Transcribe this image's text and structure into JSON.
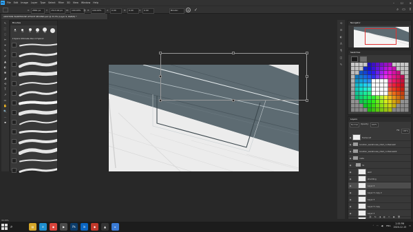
{
  "menubar": {
    "logo": "Ps",
    "items": [
      "File",
      "Edit",
      "Image",
      "Layer",
      "Type",
      "Select",
      "Filter",
      "3D",
      "View",
      "Window",
      "Help"
    ],
    "window_controls": [
      "–",
      "☐",
      "✕"
    ]
  },
  "options": {
    "x_value": "2861 px",
    "y_value": "1513.00 px",
    "w_value": "100.00%",
    "h_value": "100.00%",
    "angle": "0.00",
    "h_skew": "0.00",
    "v_skew": "0.00",
    "interpolation": "Bicubic"
  },
  "document": {
    "title": "ADDITION WAREHOUSE ATTACH SECOND.psd @ 33.3% (Layer 6, RGB/8) *"
  },
  "tools": [
    "↖",
    "⬚",
    "◌",
    "✂",
    "⌖",
    "✎",
    "✐",
    "▲",
    "◐",
    "✱",
    "◢",
    "⟲",
    "T",
    "↗",
    "▭",
    "✋",
    "🔍",
    "…",
    "▪"
  ],
  "brushes": {
    "title": "Brushes",
    "sizes": [
      {
        "size": "30",
        "d": 2
      },
      {
        "size": "30",
        "d": 3
      },
      {
        "size": "30",
        "d": 4
      },
      {
        "size": "25",
        "d": 5
      },
      {
        "size": "50",
        "d": 6
      },
      {
        "size": "",
        "d": 7
      }
    ],
    "folder": "Kyle's Ultimate Pencil Hybrid",
    "stroke_count": 14
  },
  "navigator": {
    "title": "Navigator"
  },
  "swatches": {
    "title": "Swatches"
  },
  "layers": {
    "title": "Layers",
    "blend_mode": "Normal",
    "opacity_label": "Opacity:",
    "opacity": "100%",
    "fill_label": "Fill:",
    "fill": "100%",
    "items": [
      {
        "name": "frame ref",
        "type": "layer",
        "indent": 0,
        "selected": false
      },
      {
        "name": "location_warehouse_shed_curtainwall",
        "type": "group",
        "indent": 0,
        "selected": false
      },
      {
        "name": "location_warehouse_shed_curtainwall2",
        "type": "group",
        "indent": 0,
        "selected": false
      },
      {
        "name": "vista",
        "type": "group",
        "indent": 0,
        "selected": false
      },
      {
        "name": "hs",
        "type": "group",
        "indent": 1,
        "selected": false
      },
      {
        "name": "wall",
        "type": "layer",
        "indent": 2,
        "selected": false
      },
      {
        "name": "shedding",
        "type": "layer",
        "indent": 2,
        "selected": false
      },
      {
        "name": "Layer 6",
        "type": "layer",
        "indent": 2,
        "selected": true
      },
      {
        "name": "Layer 5 copy 2",
        "type": "layer",
        "indent": 2,
        "selected": false
      },
      {
        "name": "Layer 5",
        "type": "layer",
        "indent": 2,
        "selected": false
      },
      {
        "name": "Layer 5 copy",
        "type": "layer",
        "indent": 2,
        "selected": false
      },
      {
        "name": "Layer 4",
        "type": "layer",
        "indent": 2,
        "selected": false
      },
      {
        "name": "Layer 3",
        "type": "layer",
        "indent": 2,
        "selected": false
      },
      {
        "name": "Layer 2",
        "type": "layer",
        "indent": 2,
        "selected": false
      }
    ],
    "footer_icons": [
      "⛓",
      "fx",
      "◑",
      "◐",
      "▭",
      "▣",
      "🗑"
    ]
  },
  "status": {
    "zoom": "33.33%"
  },
  "taskbar": {
    "apps": [
      {
        "name": "file-explorer",
        "glyph": "▤",
        "color": "#d6a82a"
      },
      {
        "name": "edge",
        "glyph": "e",
        "color": "#1f8fd0"
      },
      {
        "name": "chrome",
        "glyph": "◉",
        "color": "#d9453c"
      },
      {
        "name": "media",
        "glyph": "▶",
        "color": "#4b4b4b"
      },
      {
        "name": "photoshop",
        "glyph": "Ps",
        "color": "#0b3c6b"
      },
      {
        "name": "linkedin",
        "glyph": "in",
        "color": "#0a66c2"
      },
      {
        "name": "sketchup",
        "glyph": "◆",
        "color": "#c0392b"
      },
      {
        "name": "app-dark",
        "glyph": "▲",
        "color": "#333333"
      },
      {
        "name": "app-blue",
        "glyph": "▸",
        "color": "#3a7bd5"
      }
    ],
    "language": "ENG",
    "time": "2:55 PM",
    "date": "2020-12-15"
  },
  "colors": {
    "accent": "#31a8ff",
    "wall_gray": "#5d6b72"
  }
}
